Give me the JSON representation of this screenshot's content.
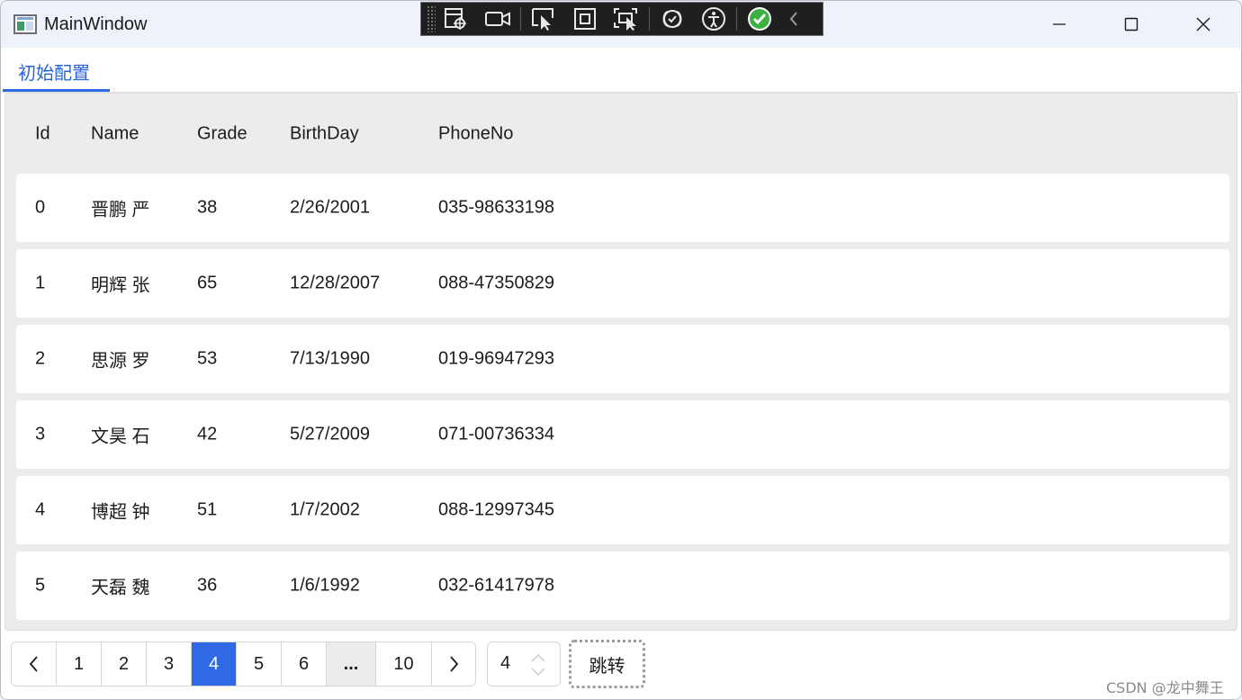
{
  "window": {
    "title": "MainWindow"
  },
  "debug_toolbar": {
    "icons": [
      "select-element-icon",
      "record-icon",
      "pointer-select-icon",
      "display-adorners-icon",
      "track-focus-icon",
      "binding-failures-icon",
      "accessibility-icon",
      "status-ok-icon",
      "collapse-chevron-icon"
    ]
  },
  "tabs": [
    {
      "label": "初始配置",
      "selected": true
    }
  ],
  "table": {
    "columns": [
      "Id",
      "Name",
      "Grade",
      "BirthDay",
      "PhoneNo"
    ],
    "rows": [
      [
        "0",
        "晋鹏 严",
        "38",
        "2/26/2001",
        "035-98633198"
      ],
      [
        "1",
        "明辉 张",
        "65",
        "12/28/2007",
        "088-47350829"
      ],
      [
        "2",
        "思源 罗",
        "53",
        "7/13/1990",
        "019-96947293"
      ],
      [
        "3",
        "文昊 石",
        "42",
        "5/27/2009",
        "071-00736334"
      ],
      [
        "4",
        "博超 钟",
        "51",
        "1/7/2002",
        "088-12997345"
      ],
      [
        "5",
        "天磊 魏",
        "36",
        "1/6/1992",
        "032-61417978"
      ]
    ]
  },
  "pagination": {
    "prev_icon": "chevron-left-icon",
    "next_icon": "chevron-right-icon",
    "pages": [
      "1",
      "2",
      "3",
      "4",
      "5",
      "6",
      "...",
      "10"
    ],
    "current_page": "4",
    "jump_value": "4",
    "jump_label": "跳转"
  },
  "colors": {
    "accent": "#2f6ae4",
    "row_background": "#ffffff",
    "content_background": "#ececec"
  },
  "watermark": "CSDN @龙中舞王"
}
